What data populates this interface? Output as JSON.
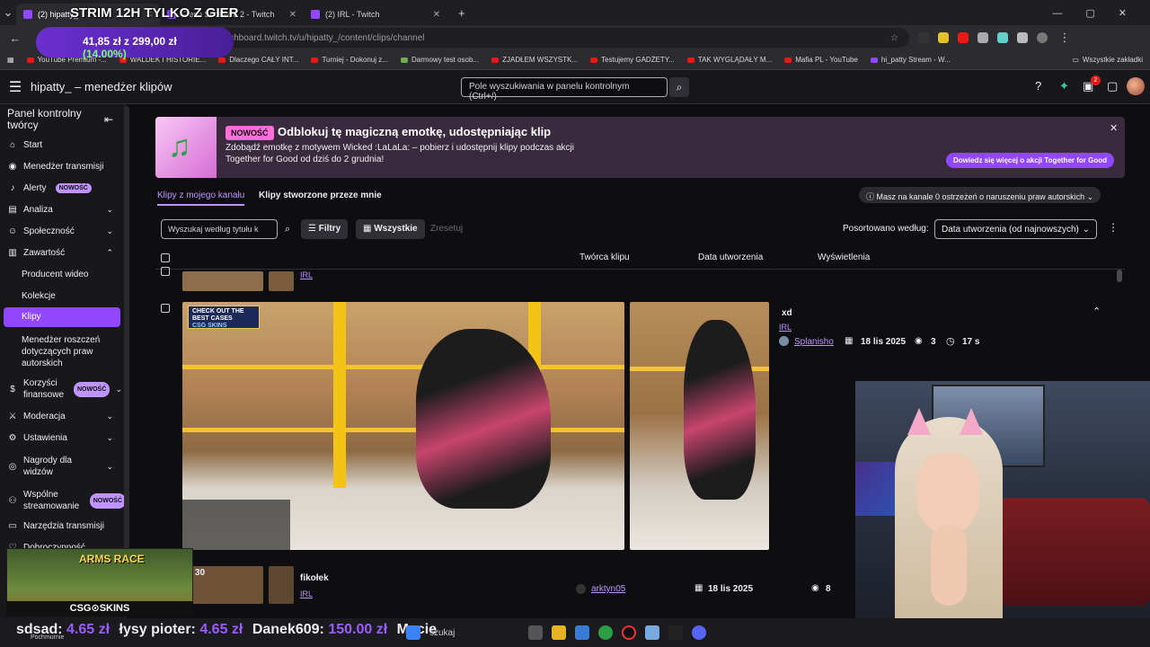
{
  "browser": {
    "tabs": [
      {
        "title": "(2) hipatty_",
        "active": true
      },
      {
        "title": "Fresh Strollecie 2 - Twitch",
        "active": false
      },
      {
        "title": "(2) IRL - Twitch",
        "active": false
      }
    ],
    "new_tab": "+",
    "url": "dashboard.twitch.tv/u/hipatty_/content/clips/channel",
    "bookmarks": [
      "YouTube Premium -...",
      "WALDEK I HISTORIE...",
      "Dlaczego CAŁY INT...",
      "Turniej - Dokonuj z...",
      "Darmowy test osob...",
      "ZJADŁEM WSZYSTK...",
      "Testujemy GADŻETY...",
      "TAK WYGLĄDAŁY M...",
      "Mafia PL - YouTube",
      "hi_patty Stream - W..."
    ],
    "all_bookmarks": "Wszystkie zakładki"
  },
  "header": {
    "title": "hipatty_ – menedżer klipów",
    "search_placeholder": "Pole wyszukiwania w panelu kontrolnym (Ctrl+/)",
    "notif_count": "2"
  },
  "sidebar": {
    "title": "Panel kontrolny twórcy",
    "items": [
      {
        "label": "Start",
        "icon": "home-icon"
      },
      {
        "label": "Menedżer transmisji",
        "icon": "broadcast-icon"
      },
      {
        "label": "Alerty",
        "icon": "bell-icon",
        "badge": "NOWOŚĆ"
      },
      {
        "label": "Analiza",
        "icon": "chart-icon"
      },
      {
        "label": "Społeczność",
        "icon": "community-icon"
      },
      {
        "label": "Zawartość",
        "icon": "content-icon"
      }
    ],
    "content_sub": [
      "Producent wideo",
      "Kolekcje",
      "Klipy",
      "Menedżer roszczeń dotyczących praw autorskich"
    ],
    "items2": [
      {
        "label": "Korzyści finansowe",
        "badge": "NOWOŚĆ"
      },
      {
        "label": "Moderacja"
      },
      {
        "label": "Ustawienia"
      },
      {
        "label": "Nagrody dla widzów"
      },
      {
        "label": "Wspólne streamowanie",
        "badge": "NOWOŚĆ"
      },
      {
        "label": "Narzędzia transmisji"
      },
      {
        "label": "Dobroczynność"
      }
    ]
  },
  "banner": {
    "badge": "NOWOŚĆ",
    "title": "Odblokuj tę magiczną emotkę, udostępniając klip",
    "desc": "Zdobądź emotkę z motywem Wicked :LaLaLa: – pobierz i udostępnij klipy podczas akcji Together for Good od dziś do 2 grudnia!",
    "button": "Dowiedz się więcej o akcji Together for Good"
  },
  "clip_tabs": [
    "Klipy z mojego kanału",
    "Klipy stworzone przeze mnie"
  ],
  "warning": "Masz na kanale 0 ostrzeżeń o naruszeniu praw autorskich",
  "filters": {
    "search_placeholder": "Wyszukaj według tytułu k",
    "filters_label": "Filtry",
    "all_label": "Wszystkie",
    "reset_label": "Zresetuj",
    "sort_label": "Posortowano według:",
    "sort_value": "Data utworzenia (od najnowszych)"
  },
  "table": {
    "headers": [
      "Twórca klipu",
      "Data utworzenia",
      "Wyświetlenia"
    ]
  },
  "clips": [
    {
      "title": "",
      "category": "IRL"
    },
    {
      "title": "xd",
      "category": "IRL",
      "creator": "Splanisho",
      "date": "18 lis 2025",
      "views": "3",
      "duration": "17 s"
    },
    {
      "title": "fikołek",
      "category": "IRL",
      "creator": "arktyn05",
      "date": "18 lis 2025",
      "views": "8",
      "duration": "30"
    }
  ],
  "overlay": {
    "title": "STRIM 12H TYLKO Z GIER",
    "goal": "41,85 zł z 299,00 zł",
    "goal_pct": "(14.00%)",
    "checkout": "CHECK OUT THE BEST CASES",
    "checkout_sub": "CSG SKINS",
    "arms_race": "ARMS RACE",
    "csgo_skins": "CSG⊙SKINS",
    "ticker": [
      {
        "name": "sdsad:",
        "amount": "4.65 zł"
      },
      {
        "name": "łysy pioter:",
        "amount": "4.65 zł"
      },
      {
        "name": "Danek609:",
        "amount": "150.00 zł"
      },
      {
        "name": "Macie",
        "amount": ""
      }
    ],
    "taskbar_search": "szukaj",
    "weather": "Pochmurnie"
  },
  "colors": {
    "accent": "#9147ff",
    "accent_light": "#bf94ff",
    "new_badge": "#ff6edb"
  }
}
